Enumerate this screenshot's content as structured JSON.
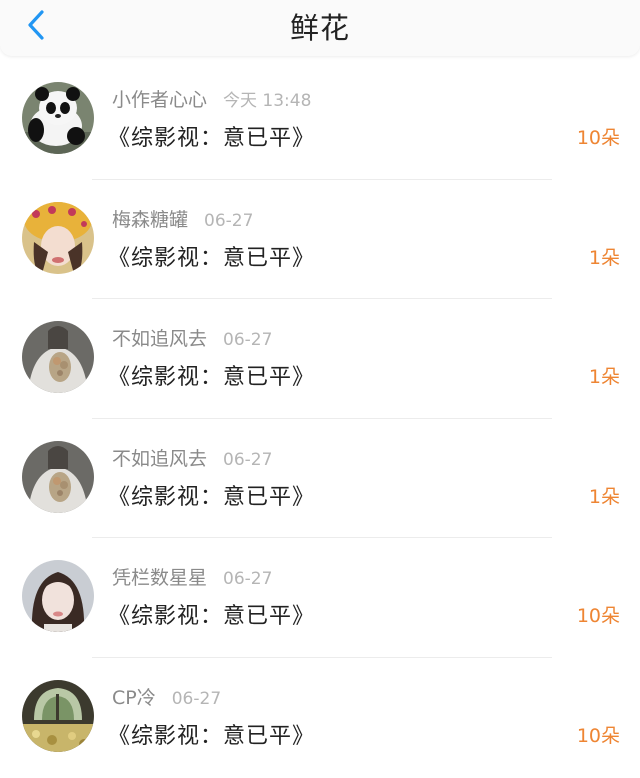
{
  "header": {
    "title": "鲜花",
    "back_icon": "chevron-left-icon",
    "accent": "#2196f3"
  },
  "colors": {
    "name": "#8a8a8a",
    "time": "#b5b5b5",
    "count": "#ee8533"
  },
  "items": [
    {
      "user": "小作者心心",
      "time": "今天 13:48",
      "book": "《综影视：意已平》",
      "count": "10朵",
      "avatar": "panda"
    },
    {
      "user": "梅森糖罐",
      "time": "06-27",
      "book": "《综影视：意已平》",
      "count": "1朵",
      "avatar": "girl-hat"
    },
    {
      "user": "不如追风去",
      "time": "06-27",
      "book": "《综影视：意已平》",
      "count": "1朵",
      "avatar": "flowers-hoodie"
    },
    {
      "user": "不如追风去",
      "time": "06-27",
      "book": "《综影视：意已平》",
      "count": "1朵",
      "avatar": "flowers-hoodie"
    },
    {
      "user": "凭栏数星星",
      "time": "06-27",
      "book": "《综影视：意已平》",
      "count": "10朵",
      "avatar": "girl-portrait"
    },
    {
      "user": "CP冷",
      "time": "06-27",
      "book": "《综影视：意已平》",
      "count": "10朵",
      "avatar": "garden-window"
    }
  ]
}
